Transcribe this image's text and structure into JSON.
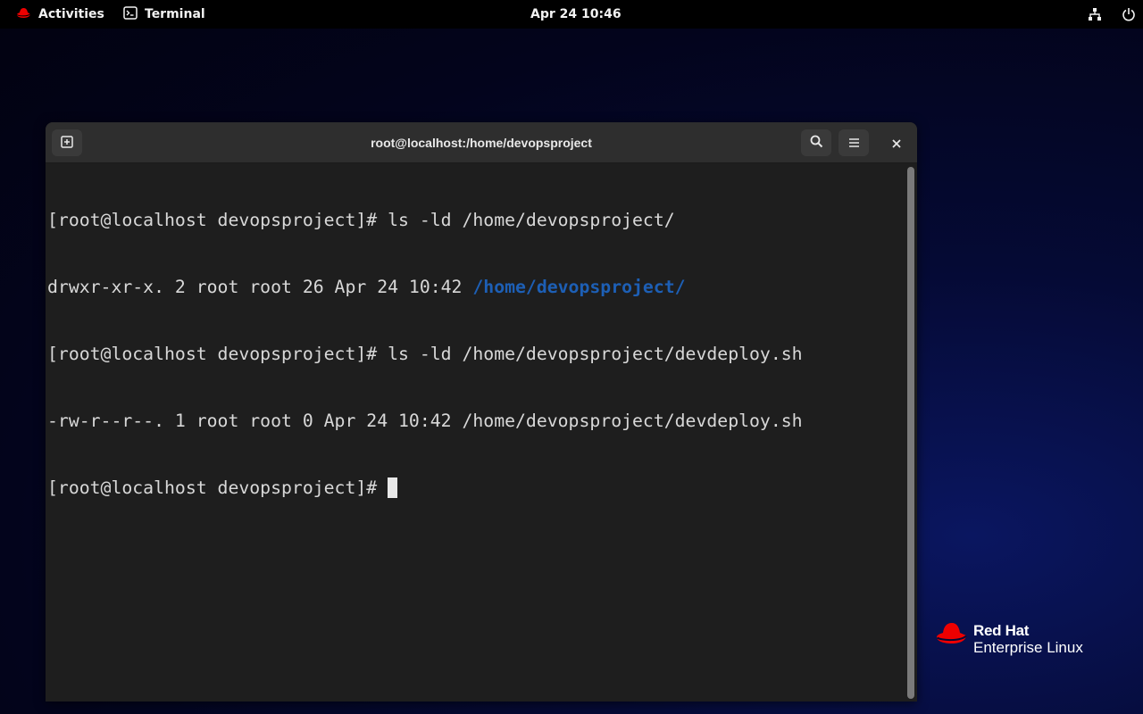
{
  "topbar": {
    "activities_label": "Activities",
    "app_label": "Terminal",
    "clock": "Apr 24  10:46",
    "icons": [
      "redhat-icon",
      "terminal-icon",
      "network-icon",
      "power-icon"
    ]
  },
  "window": {
    "title": "root@localhost:/home/devopsproject",
    "buttons": [
      "new-tab-icon",
      "search-icon",
      "menu-icon",
      "close-icon"
    ]
  },
  "terminal": {
    "lines": [
      {
        "text": "[root@localhost devopsproject]# ls -ld /home/devopsproject/"
      },
      {
        "prefix": "drwxr-xr-x. 2 root root 26 Apr 24 10:42 ",
        "highlight": "/home/devopsproject/"
      },
      {
        "text": "[root@localhost devopsproject]# ls -ld /home/devopsproject/devdeploy.sh"
      },
      {
        "text": "-rw-r--r--. 1 root root 0 Apr 24 10:42 /home/devopsproject/devdeploy.sh"
      },
      {
        "prompt": "[root@localhost devopsproject]# "
      }
    ]
  },
  "branding": {
    "brand": "Red Hat",
    "product": "Enterprise Linux"
  },
  "colors": {
    "directory": "#1d5fb5",
    "redhat_red": "#ee0000",
    "terminal_bg": "#1e1e1e",
    "headerbar_bg": "#2e2e2e"
  }
}
